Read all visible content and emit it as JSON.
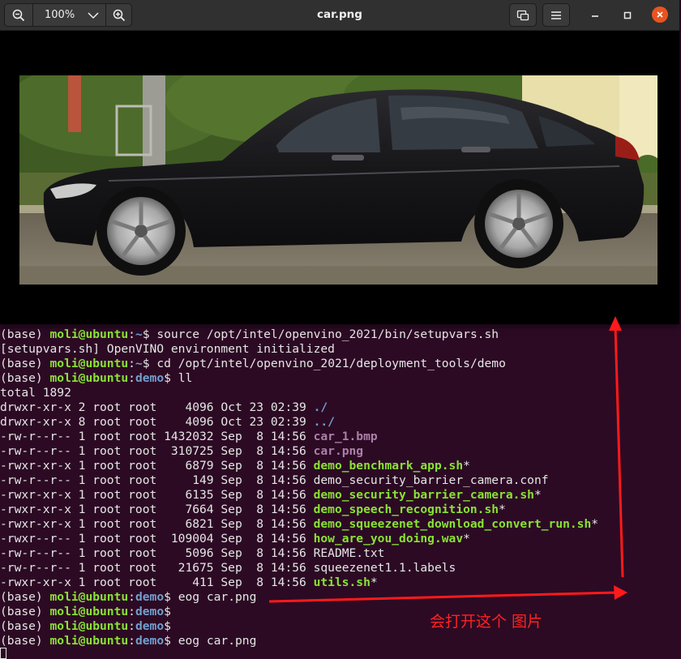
{
  "viewer": {
    "title": "car.png",
    "zoom_level": "100%",
    "icons": {
      "zoom_out": "zoom-out-icon",
      "zoom_in": "zoom-in-icon",
      "dropdown": "chevron-down-icon",
      "gallery": "gallery-icon",
      "menu": "hamburger-menu-icon",
      "minimize": "minimize-icon",
      "maximize": "maximize-icon",
      "close": "close-icon"
    },
    "accent_close": "#e95420"
  },
  "terminal": {
    "prompt_prefix": "(base) ",
    "user_host": "moli@ubuntu",
    "lines": [
      {
        "kind": "cmd",
        "path": "~",
        "cmd": " source /opt/intel/openvino_2021/bin/setupvars.sh"
      },
      {
        "kind": "out",
        "text": "[setupvars.sh] OpenVINO environment initialized"
      },
      {
        "kind": "cmd",
        "path": "~",
        "cmd": " cd /opt/intel/openvino_2021/deployment_tools/demo"
      },
      {
        "kind": "cmd",
        "path": "demo",
        "cmd": " ll"
      },
      {
        "kind": "out",
        "text": "total 1892"
      },
      {
        "kind": "ls",
        "meta": "drwxr-xr-x 2 root root    4096 Oct 23 02:39 ",
        "name": "./",
        "type": "dir",
        "suffix": ""
      },
      {
        "kind": "ls",
        "meta": "drwxr-xr-x 8 root root    4096 Oct 23 02:39 ",
        "name": "../",
        "type": "dir",
        "suffix": ""
      },
      {
        "kind": "ls",
        "meta": "-rw-r--r-- 1 root root 1432032 Sep  8 14:56 ",
        "name": "car_1.bmp",
        "type": "img",
        "suffix": ""
      },
      {
        "kind": "ls",
        "meta": "-rw-r--r-- 1 root root  310725 Sep  8 14:56 ",
        "name": "car.png",
        "type": "img",
        "suffix": ""
      },
      {
        "kind": "ls",
        "meta": "-rwxr-xr-x 1 root root    6879 Sep  8 14:56 ",
        "name": "demo_benchmark_app.sh",
        "type": "exe",
        "suffix": "*"
      },
      {
        "kind": "ls",
        "meta": "-rw-r--r-- 1 root root     149 Sep  8 14:56 ",
        "name": "demo_security_barrier_camera.conf",
        "type": "file",
        "suffix": ""
      },
      {
        "kind": "ls",
        "meta": "-rwxr-xr-x 1 root root    6135 Sep  8 14:56 ",
        "name": "demo_security_barrier_camera.sh",
        "type": "exe",
        "suffix": "*"
      },
      {
        "kind": "ls",
        "meta": "-rwxr-xr-x 1 root root    7664 Sep  8 14:56 ",
        "name": "demo_speech_recognition.sh",
        "type": "exe",
        "suffix": "*"
      },
      {
        "kind": "ls",
        "meta": "-rwxr-xr-x 1 root root    6821 Sep  8 14:56 ",
        "name": "demo_squeezenet_download_convert_run.sh",
        "type": "exe",
        "suffix": "*"
      },
      {
        "kind": "ls",
        "meta": "-rwxr--r-- 1 root root  109004 Sep  8 14:56 ",
        "name": "how_are_you_doing.wav",
        "type": "exe",
        "suffix": "*"
      },
      {
        "kind": "ls",
        "meta": "-rw-r--r-- 1 root root    5096 Sep  8 14:56 ",
        "name": "README.txt",
        "type": "file",
        "suffix": ""
      },
      {
        "kind": "ls",
        "meta": "-rw-r--r-- 1 root root   21675 Sep  8 14:56 ",
        "name": "squeezenet1.1.labels",
        "type": "file",
        "suffix": ""
      },
      {
        "kind": "ls",
        "meta": "-rwxr-xr-x 1 root root     411 Sep  8 14:56 ",
        "name": "utils.sh",
        "type": "exe",
        "suffix": "*"
      },
      {
        "kind": "cmd",
        "path": "demo",
        "cmd": " eog car.png"
      },
      {
        "kind": "cmd",
        "path": "demo",
        "cmd": ""
      },
      {
        "kind": "cmd",
        "path": "demo",
        "cmd": ""
      },
      {
        "kind": "cmd",
        "path": "demo",
        "cmd": " eog car.png"
      }
    ],
    "colors": {
      "user": "#8ae234",
      "path": "#729fcf",
      "image_file": "#ad7fa8",
      "executable": "#8ae234",
      "text": "#e6e6e6",
      "background": "#2c0a24"
    }
  },
  "annotation": {
    "text": "会打开这个 图片",
    "color": "#ff2222"
  }
}
